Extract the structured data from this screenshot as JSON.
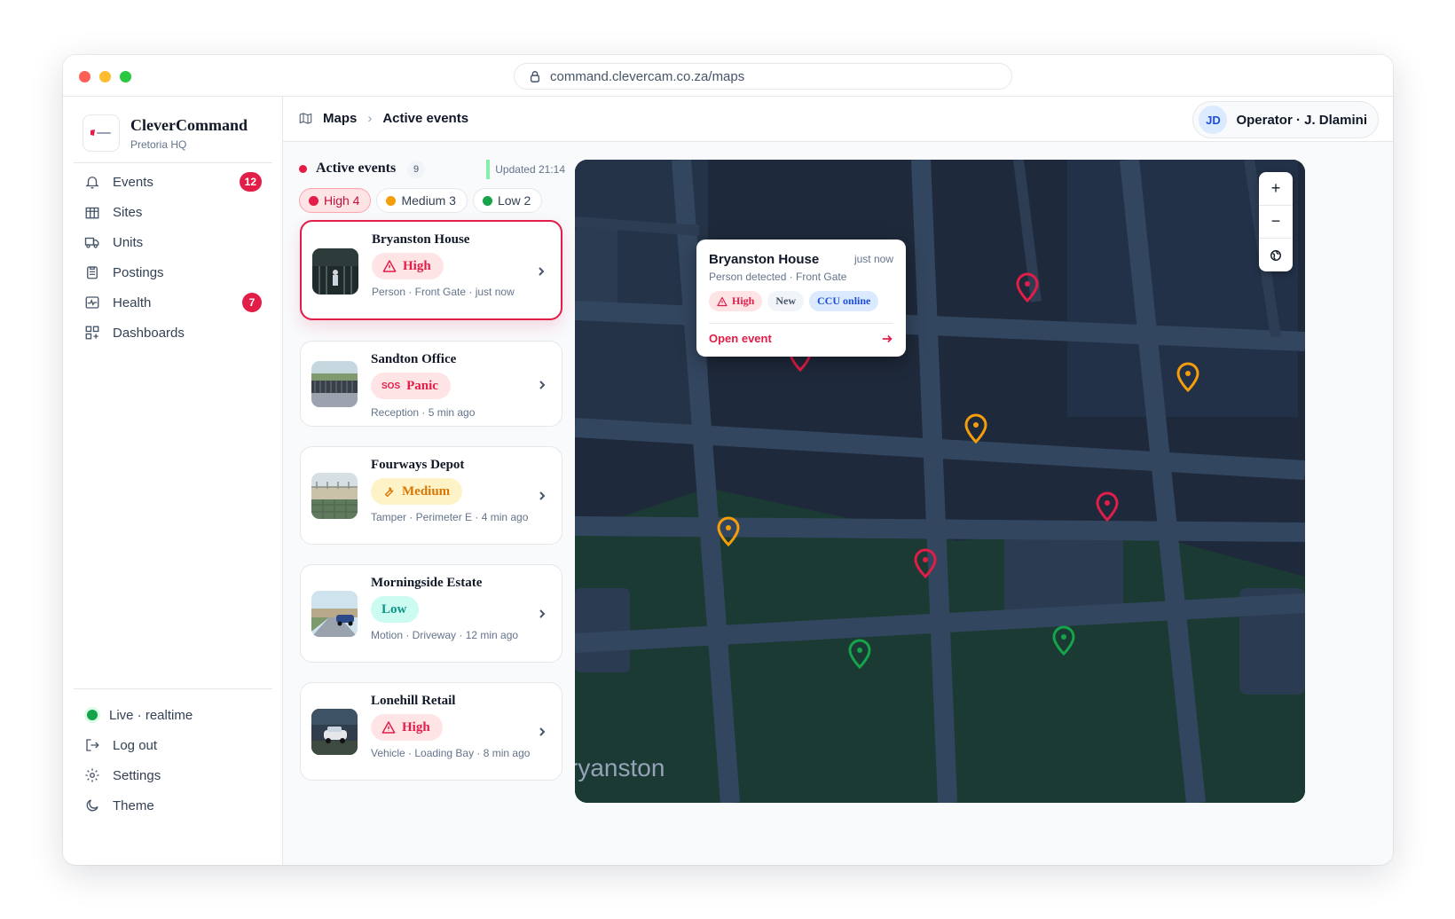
{
  "browser": {
    "url": "command.clevercam.co.za/maps"
  },
  "brand": {
    "name": "CleverCommand",
    "subtitle": "Pretoria HQ"
  },
  "nav": {
    "events": {
      "label": "Events",
      "badge": "12"
    },
    "sites": {
      "label": "Sites"
    },
    "units": {
      "label": "Units"
    },
    "postings": {
      "label": "Postings"
    },
    "health": {
      "label": "Health",
      "badge": "7"
    },
    "dashboards": {
      "label": "Dashboards"
    }
  },
  "footer": {
    "live": "Live · realtime",
    "logout": "Log out",
    "settings": "Settings",
    "theme": "Theme"
  },
  "breadcrumb": {
    "root": "Maps",
    "current": "Active events"
  },
  "user": {
    "initials": "JD",
    "label": "Operator · J. Dlamini"
  },
  "events_panel": {
    "title": "Active events",
    "count": "9",
    "updated": "Updated 21:14"
  },
  "filters": [
    {
      "label": "High 4",
      "color": "#e11d48"
    },
    {
      "label": "Medium 3",
      "color": "#f59e0b"
    },
    {
      "label": "Low 2",
      "color": "#16a34a"
    }
  ],
  "events": [
    {
      "site": "Bryanston House",
      "severity": "High",
      "meta": "Person · Front Gate · just now"
    },
    {
      "site": "Sandton Office",
      "severity": "Panic",
      "sos": "SOS",
      "meta": "Reception · 5 min ago"
    },
    {
      "site": "Fourways Depot",
      "severity": "Medium",
      "meta": "Tamper · Perimeter E · 4 min ago"
    },
    {
      "site": "Morningside Estate",
      "severity": "Low",
      "meta": "Motion · Driveway · 12 min ago"
    },
    {
      "site": "Lonehill Retail",
      "severity": "High",
      "meta": "Vehicle · Loading Bay · 8 min ago"
    }
  ],
  "map": {
    "area_label": "ryanston",
    "zoom_in": "+",
    "zoom_out": "−",
    "colors": {
      "high": "#e11d48",
      "medium": "#f59e0b",
      "low": "#16a34a"
    }
  },
  "popup": {
    "title": "Bryanston House",
    "time": "just now",
    "subtitle": "Person detected · Front Gate",
    "tags": {
      "severity": "High",
      "status": "New",
      "ccu": "CCU online"
    },
    "action": "Open event"
  }
}
